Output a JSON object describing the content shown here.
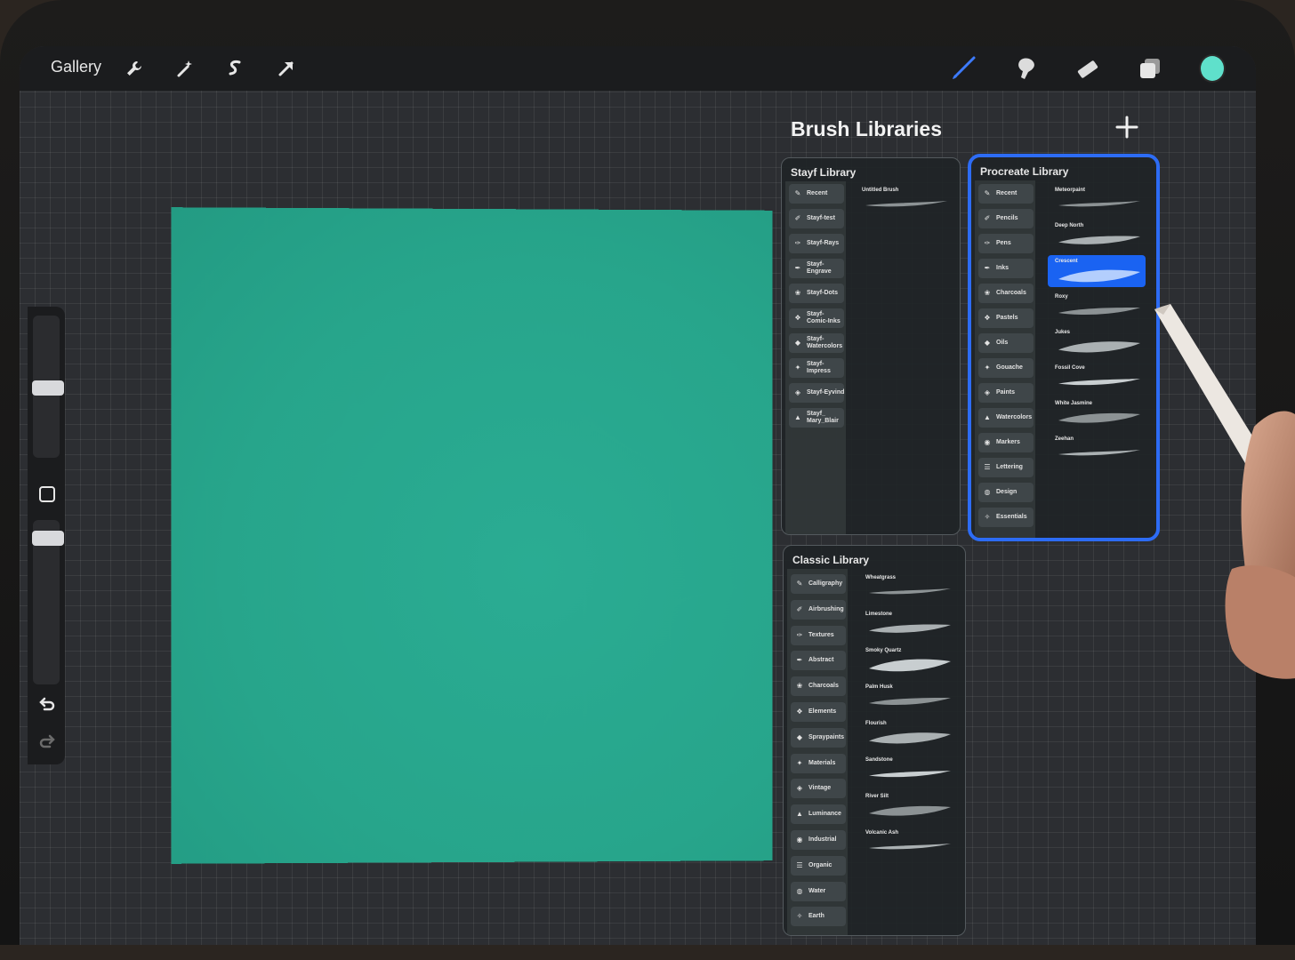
{
  "topbar": {
    "gallery_label": "Gallery",
    "left_tools": [
      "wrench-icon",
      "magic-wand-icon",
      "selection-icon",
      "transform-arrow-icon"
    ],
    "right_tools": [
      "brush-icon",
      "smudge-icon",
      "eraser-icon",
      "layers-icon",
      "color-swatch"
    ],
    "color_swatch": "#5fe0cb",
    "active_tool_color": "#3d7bff"
  },
  "canvas": {
    "color": "#27a58b"
  },
  "brush_libraries": {
    "title": "Brush Libraries",
    "add_label": "+",
    "stayf": {
      "title": "Stayf Library",
      "categories": [
        "Recent",
        "Stayf-test",
        "Stayf-Rays",
        "Stayf-\nEngrave",
        "Stayf-Dots",
        "Stayf-\nComic-Inks",
        "Stayf-\nWatercolors",
        "Stayf-\nImpress",
        "Stayf-Eyvind",
        "Stayf_\nMary_Blair"
      ],
      "brushes": [
        "Untitled Brush"
      ]
    },
    "procreate": {
      "title": "Procreate Library",
      "categories": [
        "Recent",
        "Pencils",
        "Pens",
        "Inks",
        "Charcoals",
        "Pastels",
        "Oils",
        "Gouache",
        "Paints",
        "Watercolors",
        "Markers",
        "Lettering",
        "Design",
        "Essentials"
      ],
      "brushes": [
        "Meteorpaint",
        "Deep North",
        "Crescent",
        "Roxy",
        "Jukes",
        "Fossil Cove",
        "White Jasmine",
        "Zeehan"
      ],
      "selected_brush": "Crescent",
      "selection_color": "#1a63f2"
    },
    "classic": {
      "title": "Classic Library",
      "categories": [
        "Calligraphy",
        "Airbrushing",
        "Textures",
        "Abstract",
        "Charcoals",
        "Elements",
        "Spraypaints",
        "Materials",
        "Vintage",
        "Luminance",
        "Industrial",
        "Organic",
        "Water",
        "Earth"
      ],
      "brushes": [
        "Wheatgrass",
        "Limestone",
        "Smoky Quartz",
        "Palm Husk",
        "Flourish",
        "Sandstone",
        "River Silt",
        "Volcanic Ash"
      ]
    }
  }
}
